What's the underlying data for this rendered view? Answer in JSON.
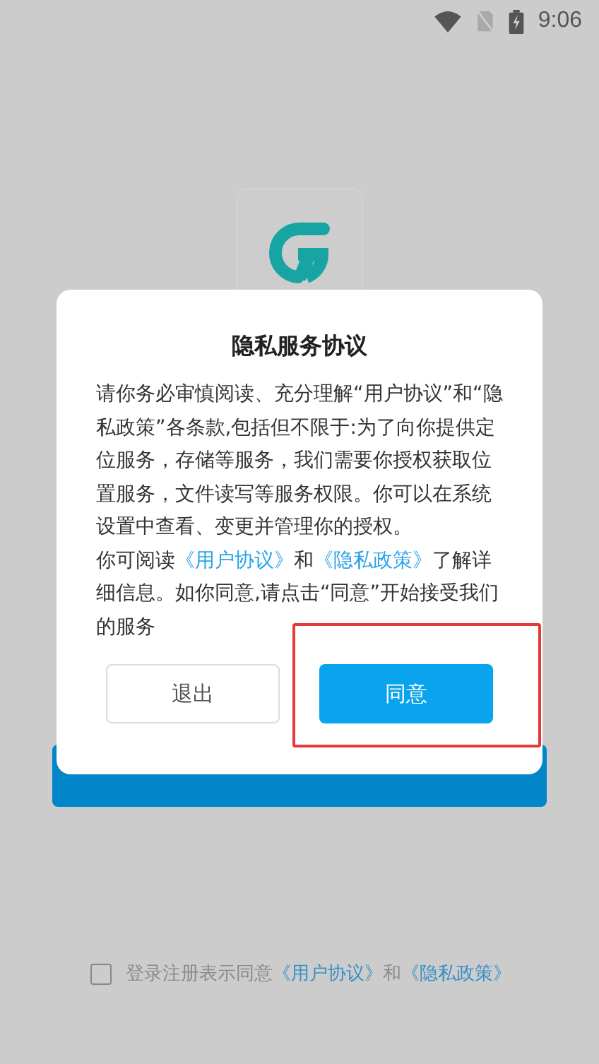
{
  "status_bar": {
    "time": "9:06"
  },
  "login": {
    "agreement": {
      "checked": false,
      "parts": [
        {
          "kind": "text",
          "text": "登录注册表示同意"
        },
        {
          "kind": "link",
          "text": "《用户协议》"
        },
        {
          "kind": "text",
          "text": "和"
        },
        {
          "kind": "link",
          "text": "《隐私政策》"
        }
      ]
    }
  },
  "dialog": {
    "title": "隐私服务协议",
    "paragraphs": [
      [
        {
          "kind": "text",
          "text": "请你务必审慎阅读、充分理解“用户协议”和“隐私政策”各条款,包括但不限于:为了向你提供定位服务，存储等服务，我们需要你授权获取位置服务，文件读写等服务权限。你可以在系统设置中查看、变更并管理你的授权。"
        }
      ],
      [
        {
          "kind": "text",
          "text": "你可阅读"
        },
        {
          "kind": "link",
          "text": "《用户协议》"
        },
        {
          "kind": "text",
          "text": "和"
        },
        {
          "kind": "link",
          "text": "《隐私政策》"
        },
        {
          "kind": "text",
          "text": "了解详细信息。如你同意,请点击“同意”开始接受我们的服务"
        }
      ]
    ],
    "buttons": [
      {
        "label": "退出",
        "kind": "secondary",
        "highlighted": false
      },
      {
        "label": "同意",
        "kind": "primary",
        "highlighted": true
      }
    ]
  }
}
